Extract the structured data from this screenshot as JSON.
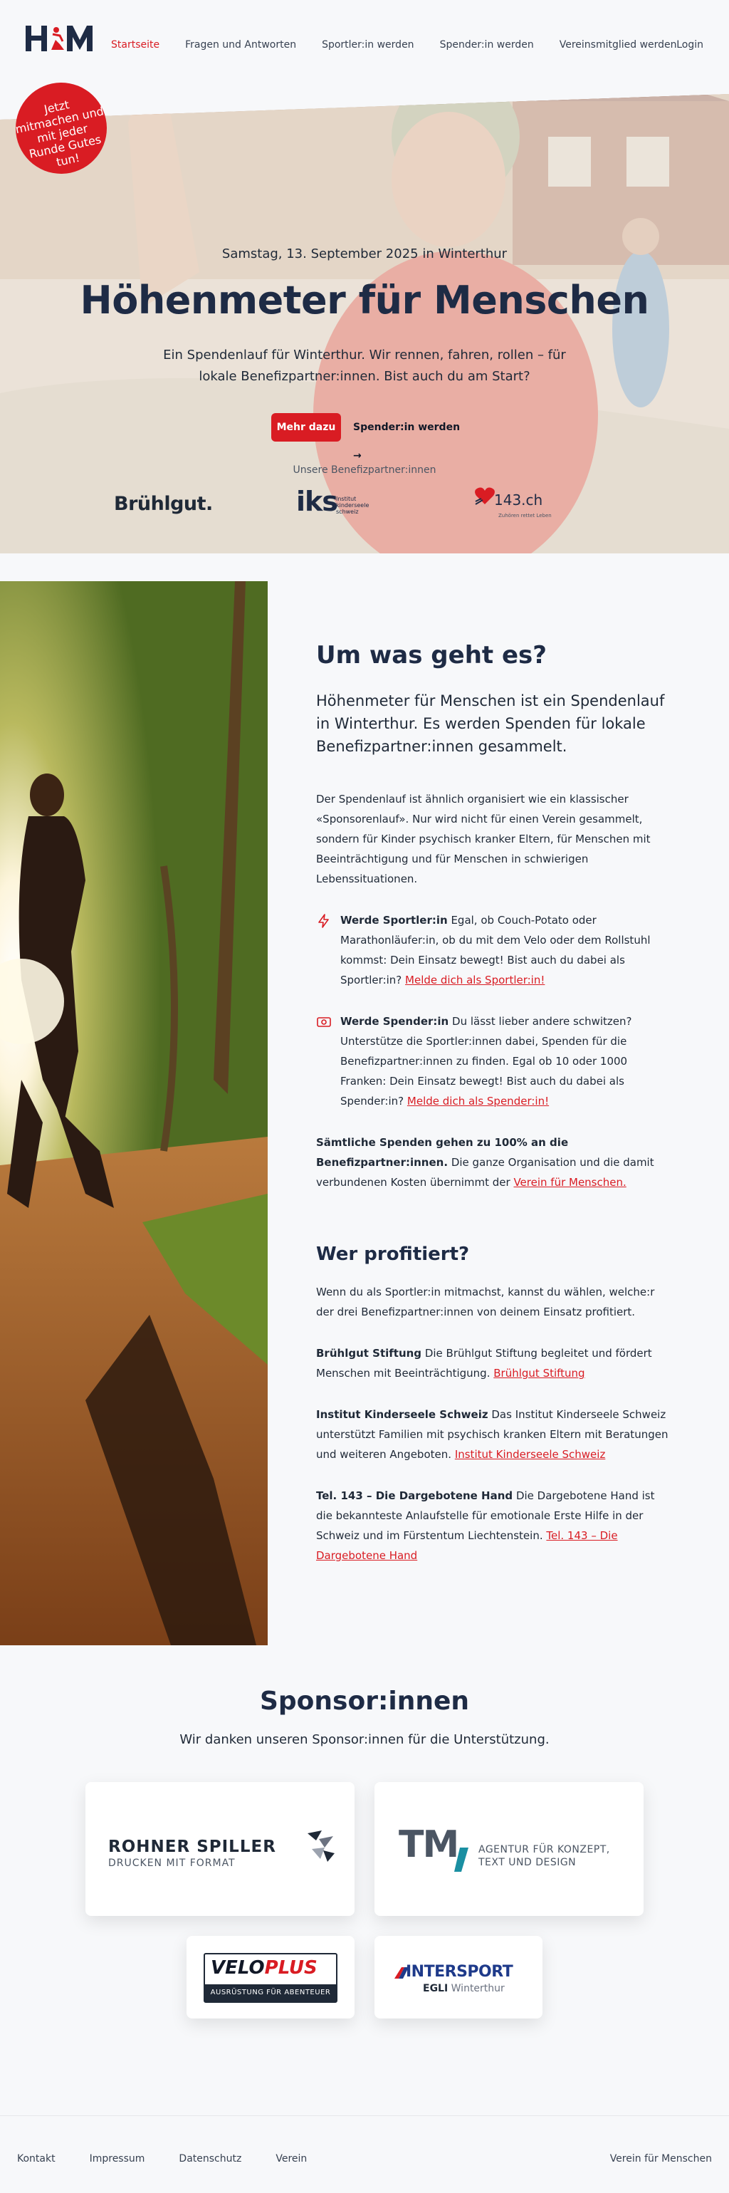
{
  "brand": {
    "accent": "#d91c23",
    "navy": "#1e2b45",
    "logo_text": "HfM"
  },
  "nav": {
    "items": [
      {
        "label": "Startseite",
        "active": true
      },
      {
        "label": "Fragen und Antworten"
      },
      {
        "label": "Sportler:in werden"
      },
      {
        "label": "Spender:in werden"
      },
      {
        "label": "Vereinsmitglied werden"
      }
    ],
    "login": "Login"
  },
  "hero": {
    "badge": "Jetzt mitmachen und mit jeder Runde Gutes tun!",
    "date": "Samstag, 13. September 2025 in Winterthur",
    "title": "Höhenmeter für Menschen",
    "text": "Ein Spendenlauf für Winterthur. Wir rennen, fahren, rollen – für lokale Benefizpartner:innen. Bist auch du am Start?",
    "primary_button": "Mehr dazu",
    "secondary_button": "Spender:in werden →",
    "partners_caption": "Unsere Benefizpartner:innen",
    "partners": [
      {
        "name": "Brühlgut."
      },
      {
        "mark": "iks",
        "line1": "Institut",
        "line2": "kinderseele",
        "line3": "schweiz"
      },
      {
        "name": "143.ch",
        "tagline": "Zuhören rettet Leben"
      }
    ]
  },
  "about": {
    "title": "Um was geht es?",
    "lead": "Höhenmeter für Menschen ist ein Spendenlauf in Winterthur. Es werden Spenden für lokale Benefizpartner:innen gesammelt.",
    "paragraph": "Der Spendenlauf ist ähnlich organisiert wie ein klassischer «Sponsorenlauf». Nur wird nicht für einen Verein gesammelt, sondern für Kinder psychisch kranker Eltern, für Menschen mit Beeinträchtigung und für Menschen in schwierigen Lebenssituationen.",
    "features": [
      {
        "icon": "bolt-icon",
        "title": "Werde Sportler:in",
        "text": "Egal, ob Couch-Potato oder Marathonläufer:in, ob du mit dem Velo oder dem Rollstuhl kommst: Dein Einsatz bewegt! Bist auch du dabei als Sportler:in?",
        "link": "Melde dich als Sportler:in!"
      },
      {
        "icon": "money-icon",
        "title": "Werde Spender:in",
        "text": "Du lässt lieber andere schwitzen? Unterstütze die Sportler:innen dabei, Spenden für die Benefizpartner:innen zu finden. Egal ob 10 oder 1000 Franken: Dein Einsatz bewegt! Bist auch du dabei als Spender:in?",
        "link": "Melde dich als Spender:in!"
      }
    ],
    "donation_bold": "Sämtliche Spenden gehen zu 100% an die Benefizpartner:innen.",
    "donation_text": "Die ganze Organisation und die damit verbundenen Kosten übernimmt der",
    "donation_link": "Verein für Menschen."
  },
  "benefit": {
    "title": "Wer profitiert?",
    "intro": "Wenn du als Sportler:in mitmachst, kannst du wählen, welche:r der drei Benefizpartner:innen von deinem Einsatz profitiert.",
    "partners": [
      {
        "name": "Brühlgut Stiftung",
        "text": "Die Brühlgut Stiftung begleitet und fördert Menschen mit Beeinträchtigung.",
        "link": "Brühlgut Stiftung"
      },
      {
        "name": "Institut Kinderseele Schweiz",
        "text": "Das Institut Kinderseele Schweiz unterstützt Familien mit psychisch kranken Eltern mit Beratungen und weiteren Angeboten.",
        "link": "Institut Kinderseele Schweiz"
      },
      {
        "name": "Tel. 143 – Die Dargebotene Hand",
        "text": "Die Dargebotene Hand ist die bekannteste Anlaufstelle für emotionale Erste Hilfe in der Schweiz und im Fürstentum Liechtenstein.",
        "link": "Tel. 143 – Die Dargebotene Hand"
      }
    ]
  },
  "sponsors": {
    "title": "Sponsor:innen",
    "subtitle": "Wir danken unseren Sponsor:innen für die Unterstützung.",
    "items": [
      {
        "name": "ROHNER SPILLER",
        "tagline": "DRUCKEN MIT FORMAT"
      },
      {
        "mark": "TM",
        "line1": "AGENTUR FÜR KONZEPT,",
        "line2": "TEXT UND DESIGN"
      },
      {
        "name1": "VELO",
        "name2": "PLUS",
        "tagline": "AUSRÜSTUNG FÜR ABENTEUER"
      },
      {
        "name": "INTERSPORT",
        "line1": "EGLI",
        "line2": "Winterthur"
      }
    ]
  },
  "footer": {
    "links": [
      "Kontakt",
      "Impressum",
      "Datenschutz",
      "Verein"
    ],
    "right": "Verein für Menschen"
  }
}
